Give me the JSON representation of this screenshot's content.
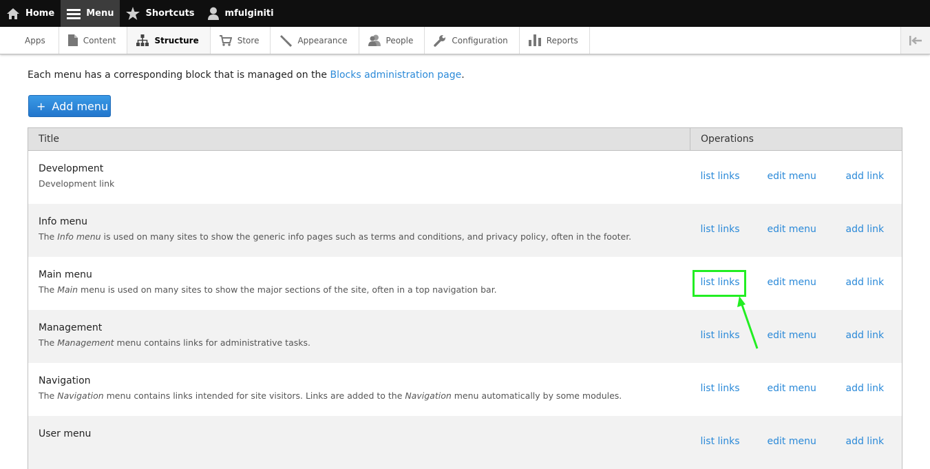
{
  "toolbar": {
    "home": "Home",
    "menu": "Menu",
    "shortcuts": "Shortcuts",
    "user": "mfulginiti"
  },
  "tray": {
    "apps": "Apps",
    "content": "Content",
    "structure": "Structure",
    "store": "Store",
    "appearance": "Appearance",
    "people": "People",
    "configuration": "Configuration",
    "reports": "Reports"
  },
  "intro": {
    "text": "Each menu has a corresponding block that is managed on the ",
    "link": "Blocks administration page",
    "end": "."
  },
  "add_menu": "Add menu",
  "table": {
    "col_title": "Title",
    "col_ops": "Operations",
    "op_list": "list links",
    "op_edit": "edit menu",
    "op_add": "add link",
    "rows": [
      {
        "name": "Development",
        "pre": "Development link",
        "em": "",
        "post": ""
      },
      {
        "name": "Info menu",
        "pre": "The ",
        "em": "Info menu",
        "post": " is used on many sites to show the generic info pages such as terms and conditions, and privacy policy, often in the footer."
      },
      {
        "name": "Main menu",
        "pre": "The ",
        "em": "Main",
        "post": " menu is used on many sites to show the major sections of the site, often in a top navigation bar."
      },
      {
        "name": "Management",
        "pre": "The ",
        "em": "Management",
        "post": " menu contains links for administrative tasks."
      },
      {
        "name": "Navigation",
        "pre": "The ",
        "em": "Navigation",
        "post": " menu contains links intended for site visitors. Links are added to the ",
        "em2": "Navigation",
        "post2": " menu automatically by some modules."
      },
      {
        "name": "User menu",
        "pre": "",
        "em": "",
        "post": ""
      }
    ]
  },
  "colors": {
    "accent": "#2a89d8",
    "highlight": "#22ee22",
    "toolbar": "#0f0f0f"
  }
}
